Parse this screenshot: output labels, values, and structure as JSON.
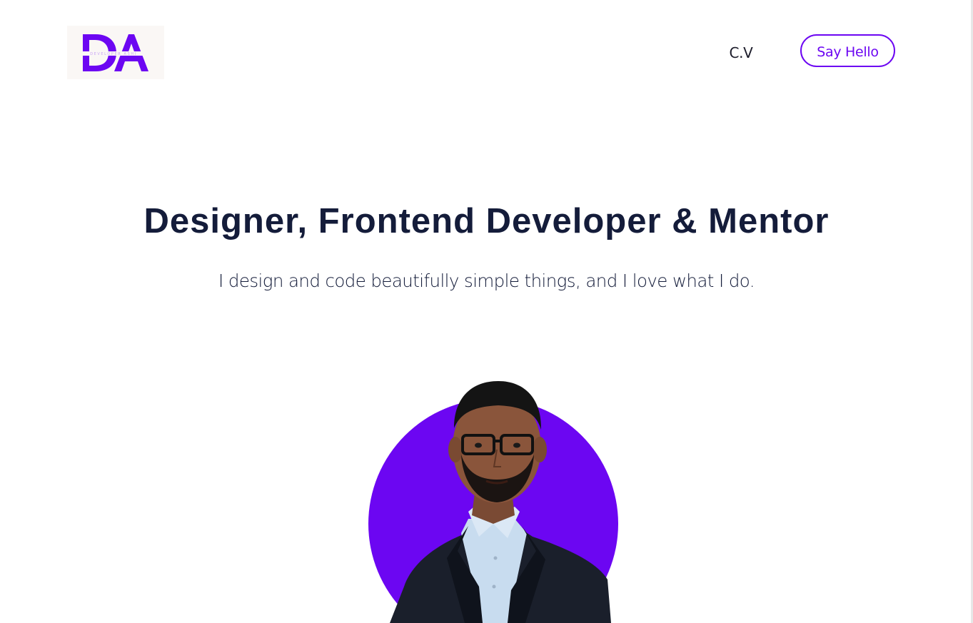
{
  "header": {
    "logo_letters": "DA",
    "logo_tagline": "DEVELOPER ASHI",
    "nav_cv_label": "C.V",
    "cta_label": "Say Hello"
  },
  "hero": {
    "title": "Designer, Frontend Developer & Mentor",
    "subtitle": "I design and code beautifully simple things, and I love what I do."
  },
  "colors": {
    "accent": "#6c06f2",
    "heading": "#141c3a",
    "background": "#ffffff"
  }
}
